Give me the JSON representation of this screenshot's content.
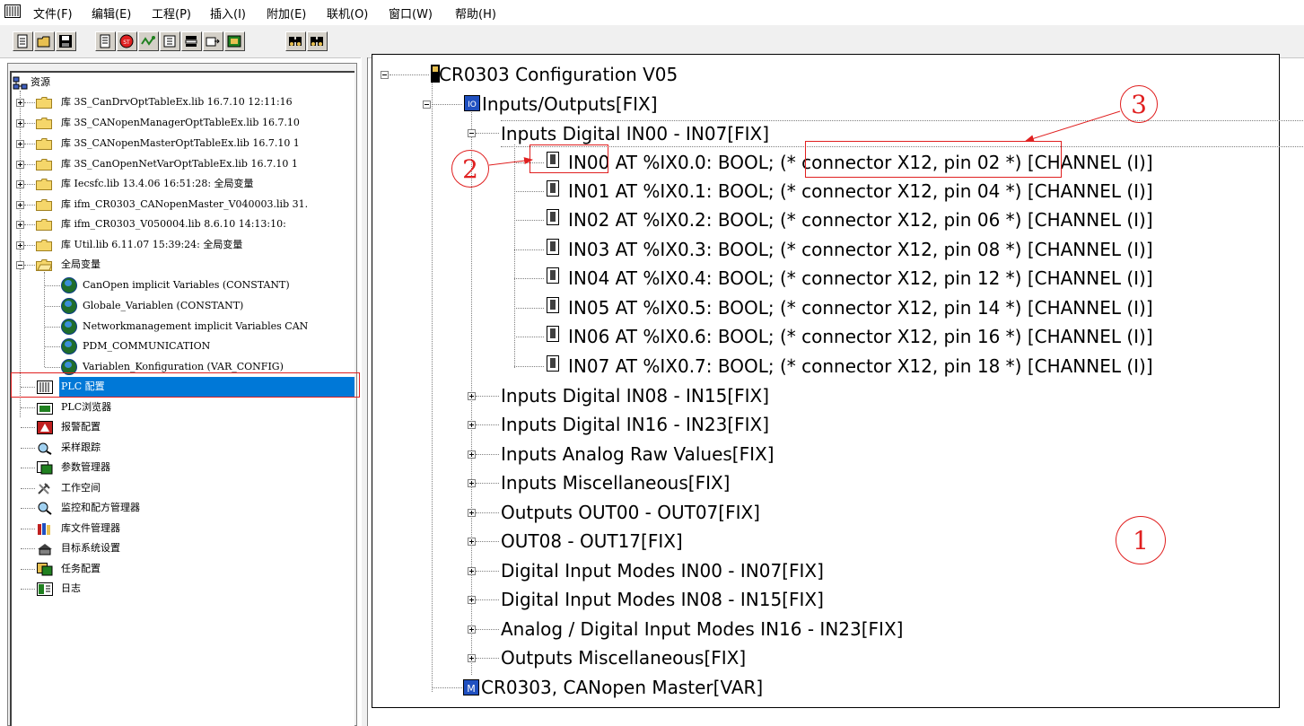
{
  "menubar": {
    "items": [
      "文件(F)",
      "编辑(E)",
      "工程(P)",
      "插入(I)",
      "附加(E)",
      "联机(O)",
      "窗口(W)",
      "帮助(H)"
    ]
  },
  "toolbar": {
    "buttons": [
      "new-icon",
      "open-icon",
      "save-icon",
      "build-icon",
      "stop-icon",
      "run-icon",
      "step-icon",
      "io-icon",
      "login-icon",
      "logout-icon",
      "find-icon",
      "find-replace-icon"
    ]
  },
  "resources": {
    "root_label": "资源",
    "libraries": [
      {
        "prefix": "库",
        "name": "3S_CanDrvOptTableEx.lib 16.7.10 12:11:16"
      },
      {
        "prefix": "库",
        "name": "3S_CANopenManagerOptTableEx.lib 16.7.10"
      },
      {
        "prefix": "库",
        "name": "3S_CANopenMasterOptTableEx.lib 16.7.10 1"
      },
      {
        "prefix": "库",
        "name": "3S_CanOpenNetVarOptTableEx.lib 16.7.10 1"
      },
      {
        "prefix": "库",
        "name": "Iecsfc.lib 13.4.06 16:51:28: 全局变量"
      },
      {
        "prefix": "库",
        "name": "ifm_CR0303_CANopenMaster_V040003.lib 31."
      },
      {
        "prefix": "库",
        "name": "ifm_CR0303_V050004.lib 8.6.10 14:13:10:"
      },
      {
        "prefix": "库",
        "name": "Util.lib 6.11.07 15:39:24: 全局变量"
      }
    ],
    "global_vars_label": "全局变量",
    "global_vars": [
      "CanOpen implicit Variables (CONSTANT)",
      "Globale_Variablen (CONSTANT)",
      "Networkmanagement implicit Variables CAN",
      "PDM_COMMUNICATION",
      "Variablen_Konfiguration (VAR_CONFIG)"
    ],
    "items": [
      {
        "label": "PLC 配置",
        "icon": "plc-config-icon",
        "selected": true
      },
      {
        "label": "PLC浏览器",
        "icon": "plc-browser-icon"
      },
      {
        "label": "报警配置",
        "icon": "alarm-config-icon"
      },
      {
        "label": "采样跟踪",
        "icon": "sampling-trace-icon"
      },
      {
        "label": "参数管理器",
        "icon": "parameter-manager-icon"
      },
      {
        "label": "工作空间",
        "icon": "workspace-icon"
      },
      {
        "label": "监控和配方管理器",
        "icon": "watch-recipe-icon"
      },
      {
        "label": "库文件管理器",
        "icon": "library-manager-icon"
      },
      {
        "label": "目标系统设置",
        "icon": "target-settings-icon"
      },
      {
        "label": "任务配置",
        "icon": "task-config-icon"
      },
      {
        "label": "日志",
        "icon": "log-icon"
      }
    ]
  },
  "config": {
    "root": "CR0303 Configuration V05",
    "io": "Inputs/Outputs[FIX]",
    "digital_group": "Inputs Digital IN00 - IN07[FIX]",
    "channels": [
      {
        "name": "IN00 AT",
        "addr": "%IX0.0: BOOL;",
        "comment": "(* connector X12, pin 02 *)",
        "tag": "[CHANNEL (I)]"
      },
      {
        "name": "IN01 AT",
        "addr": "%IX0.1: BOOL;",
        "comment": "(* connector X12, pin 04 *)",
        "tag": "[CHANNEL (I)]"
      },
      {
        "name": "IN02 AT",
        "addr": "%IX0.2: BOOL;",
        "comment": "(* connector X12, pin 06 *)",
        "tag": "[CHANNEL (I)]"
      },
      {
        "name": "IN03 AT",
        "addr": "%IX0.3: BOOL;",
        "comment": "(* connector X12, pin 08 *)",
        "tag": "[CHANNEL (I)]"
      },
      {
        "name": "IN04 AT",
        "addr": "%IX0.4: BOOL;",
        "comment": "(* connector X12, pin 12 *)",
        "tag": "[CHANNEL (I)]"
      },
      {
        "name": "IN05 AT",
        "addr": "%IX0.5: BOOL;",
        "comment": "(* connector X12, pin 14 *)",
        "tag": "[CHANNEL (I)]"
      },
      {
        "name": "IN06 AT",
        "addr": "%IX0.6: BOOL;",
        "comment": "(* connector X12, pin 16 *)",
        "tag": "[CHANNEL (I)]"
      },
      {
        "name": "IN07 AT",
        "addr": "%IX0.7: BOOL;",
        "comment": "(* connector X12, pin 18 *)",
        "tag": "[CHANNEL (I)]"
      }
    ],
    "groups": [
      "Inputs Digital IN08 - IN15[FIX]",
      "Inputs Digital IN16 - IN23[FIX]",
      "Inputs Analog Raw Values[FIX]",
      "Inputs Miscellaneous[FIX]",
      "Outputs OUT00 - OUT07[FIX]",
      "OUT08 - OUT17[FIX]",
      "Digital Input Modes IN00 - IN07[FIX]",
      "Digital Input Modes IN08 - IN15[FIX]",
      "Analog / Digital Input Modes IN16 - IN23[FIX]",
      "Outputs Miscellaneous[FIX]"
    ],
    "master": "CR0303, CANopen Master[VAR]"
  },
  "annotations": {
    "callout_1": "1",
    "callout_2": "2",
    "callout_3": "3",
    "color": "#e02020"
  },
  "colors": {
    "selection": "#0078d7",
    "annotation": "#e02020"
  }
}
